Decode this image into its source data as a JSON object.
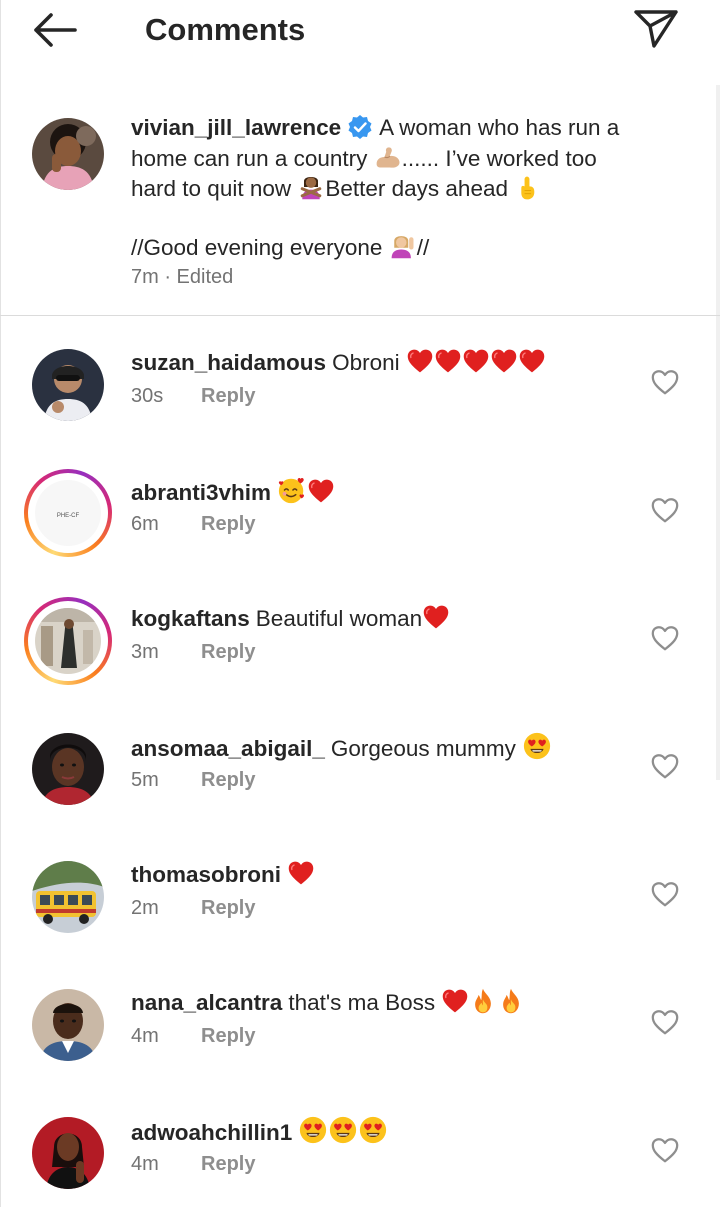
{
  "header": {
    "title": "Comments",
    "back_icon": "arrow-left-icon",
    "share_icon": "paper-plane-icon"
  },
  "caption": {
    "username": "vivian_jill_lawrence",
    "verified": true,
    "line1_text": "A woman who has run a",
    "line2_text": "home can run a country ",
    "line2_tail": "...... I’ve worked too",
    "line3_text": "hard to quit now ",
    "line3_mid": "Better days ahead ",
    "line5_text": "//Good evening everyone ",
    "line5_tail": "//",
    "meta": "7m · Edited"
  },
  "comments": [
    {
      "username": "suzan_haidamous",
      "text": "Obroni",
      "time": "30s",
      "reply": "Reply"
    },
    {
      "username": "abranti3vhim",
      "text": "",
      "time": "6m",
      "reply": "Reply"
    },
    {
      "username": "kogkaftans",
      "text": "Beautiful woman",
      "time": "3m",
      "reply": "Reply"
    },
    {
      "username": "ansomaa_abigail_",
      "text": "Gorgeous mummy",
      "time": "5m",
      "reply": "Reply"
    },
    {
      "username": "thomasobroni",
      "text": "",
      "time": "2m",
      "reply": "Reply"
    },
    {
      "username": "nana_alcantra",
      "text": "that's ma Boss",
      "time": "4m",
      "reply": "Reply"
    },
    {
      "username": "adwoahchillin1",
      "text": "",
      "time": "4m",
      "reply": "Reply"
    }
  ],
  "colors": {
    "text": "#262626",
    "secondary": "#737373",
    "verified_blue": "#3897f0",
    "heart_red": "#e0201f",
    "divider": "#dbdbdb"
  }
}
